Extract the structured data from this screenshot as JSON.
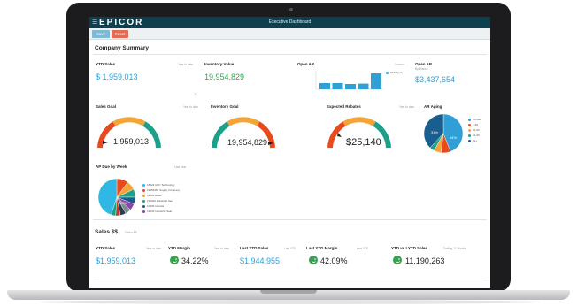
{
  "app": {
    "logo": "EPICOR",
    "title": "Executive Dashboard"
  },
  "toolbar": {
    "save_label": "Save",
    "reset_label": "Reset"
  },
  "company_summary": {
    "title": "Company Summary",
    "ytd_sales": {
      "title": "YTD Sales",
      "period": "Year to date",
      "value": "$ 1,959,013"
    },
    "inventory_value": {
      "title": "Inventory Value",
      "value": "19,954,829"
    },
    "open_ar": {
      "title": "Open AR",
      "period": "Custom",
      "legend": "EFP Apply"
    },
    "open_ap": {
      "title": "Open AP",
      "sub": "By Branch",
      "value": "$3,437,654"
    },
    "sales_goal": {
      "title": "Sales Goal",
      "period": "Year to date",
      "value": "1,959,013"
    },
    "inventory_goal": {
      "title": "Inventory Goal",
      "value": "19,954,829"
    },
    "expected_rebates": {
      "title": "Expected Rebates",
      "period": "Year to date",
      "value": "$25,140"
    },
    "ar_aging": {
      "title": "AR Aging",
      "slices": [
        {
          "label": "Current",
          "value": 44,
          "color": "#2f9fd6"
        },
        {
          "label": "1-30",
          "value": 8,
          "color": "#e8491d"
        },
        {
          "label": "31-60",
          "value": 6,
          "color": "#f4a53a"
        },
        {
          "label": "61-90",
          "value": 4,
          "color": "#1e9f8a"
        },
        {
          "label": "91+",
          "value": 38,
          "color": "#1a5d8f"
        }
      ],
      "label_a": "31%",
      "label_b": "44%"
    },
    "ap_due": {
      "title": "AP Due by Week",
      "period": "Last Year",
      "label": "10%",
      "legend": [
        "18123 UPC Technology",
        "19056481 Supply Company",
        "18093 Reed",
        "192020 Industrial Sec",
        "10939 Intertek",
        "19033 Industrial Sale"
      ],
      "legend_colors": [
        "#2fb7e6",
        "#e8491d",
        "#f4a53a",
        "#1e9f8a",
        "#1a5d8f",
        "#8e44ad"
      ]
    }
  },
  "sales": {
    "title": "Sales $$",
    "sub": "Sales $$",
    "ytd_sales": {
      "title": "YTD Sales",
      "period": "Year to date",
      "value": "$1,959,013"
    },
    "ytd_margin": {
      "title": "YTD Margin",
      "period": "Year to date",
      "value": "34.22%"
    },
    "last_ytd_sales": {
      "title": "Last YTD Sales",
      "period": "Last YTD",
      "value": "$1,944,955"
    },
    "last_ytd_margin": {
      "title": "Last YTD Margin",
      "period": "Last YTD",
      "value": "42.09%"
    },
    "ytd_vs_lytd": {
      "title": "YTD vs LYTD Sales",
      "period": "Trailing 12 Months",
      "value": "11,190,263"
    }
  },
  "colors": {
    "header": "#0e3f4f",
    "accent_blue": "#2f9fd6",
    "gauge_red": "#e8491d",
    "gauge_orange": "#f4a53a",
    "gauge_green": "#1e9f8a"
  }
}
